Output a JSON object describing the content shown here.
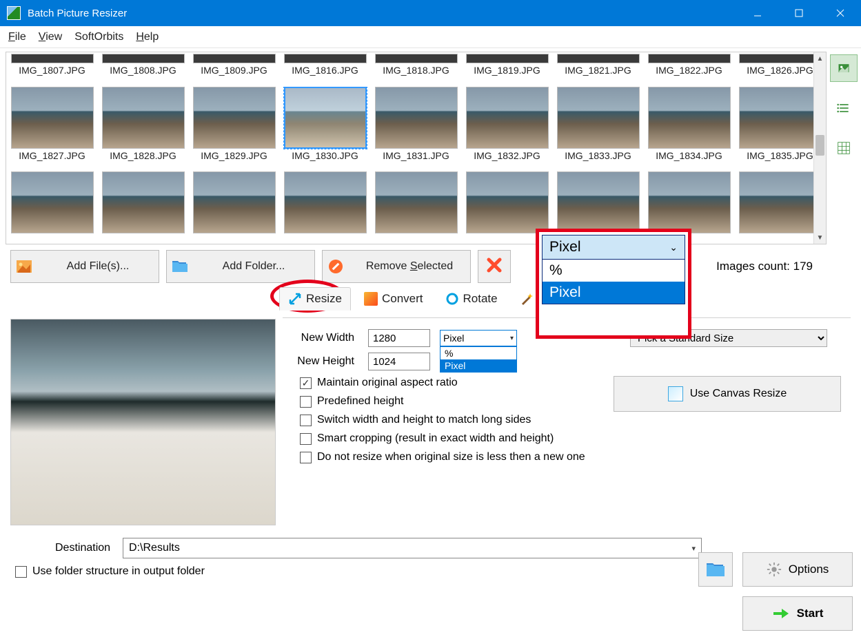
{
  "title": "Batch Picture Resizer",
  "menu": {
    "file": "File",
    "view": "View",
    "softorbits": "SoftOrbits",
    "help": "Help"
  },
  "gallery_r1": [
    "IMG_1807.JPG",
    "IMG_1808.JPG",
    "IMG_1809.JPG",
    "IMG_1816.JPG",
    "IMG_1818.JPG",
    "IMG_1819.JPG",
    "IMG_1821.JPG",
    "IMG_1822.JPG",
    "IMG_1826.JPG"
  ],
  "gallery_r2": [
    "IMG_1827.JPG",
    "IMG_1828.JPG",
    "IMG_1829.JPG",
    "IMG_1830.JPG",
    "IMG_1831.JPG",
    "IMG_1832.JPG",
    "IMG_1833.JPG",
    "IMG_1834.JPG",
    "IMG_1835.JPG"
  ],
  "selected_thumb": "IMG_1830.JPG",
  "toolbar": {
    "add_files": "Add File(s)...",
    "add_folder": "Add Folder...",
    "remove_selected": "Remove Selected",
    "images_count_label": "Images count: 179"
  },
  "tabs": {
    "resize": "Resize",
    "convert": "Convert",
    "rotate": "Rotate",
    "effects": "Effe"
  },
  "resize": {
    "new_width_label": "New Width",
    "new_width_value": "1280",
    "new_height_label": "New Height",
    "new_height_value": "1024",
    "unit_selected": "Pixel",
    "unit_options": [
      "%",
      "Pixel"
    ],
    "std_size_placeholder": "Pick a Standard Size",
    "maintain_ratio": "Maintain original aspect ratio",
    "predefined_height": "Predefined height",
    "switch_wh": "Switch width and height to match long sides",
    "smart_crop": "Smart cropping (result in exact width and height)",
    "no_resize_smaller": "Do not resize when original size is less then a new one",
    "canvas_btn": "Use Canvas Resize"
  },
  "callout": {
    "selected": "Pixel",
    "options": [
      "%",
      "Pixel"
    ]
  },
  "destination": {
    "label": "Destination",
    "path": "D:\\Results",
    "use_folder_structure": "Use folder structure in output folder"
  },
  "buttons": {
    "options": "Options",
    "start": "Start"
  }
}
